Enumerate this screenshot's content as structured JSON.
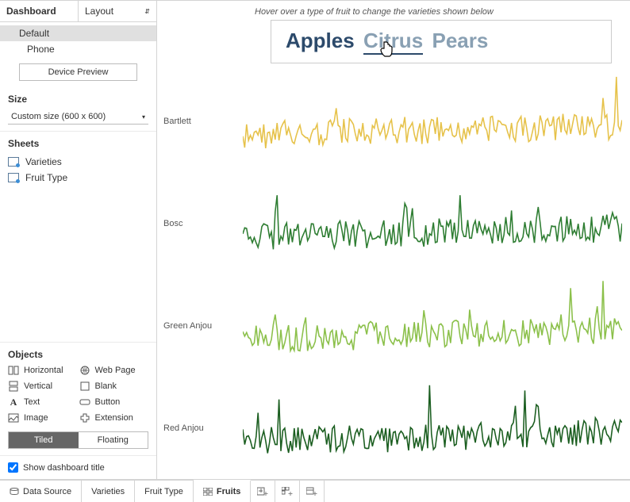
{
  "sidebar": {
    "top_tabs": {
      "dashboard": "Dashboard",
      "layout": "Layout"
    },
    "devices": {
      "default": "Default",
      "phone": "Phone"
    },
    "preview_btn": "Device Preview",
    "size": {
      "title": "Size",
      "value": "Custom size (600 x 600)"
    },
    "sheets": {
      "title": "Sheets",
      "items": [
        "Varieties",
        "Fruit Type"
      ]
    },
    "objects": {
      "title": "Objects",
      "items": [
        {
          "label": "Horizontal"
        },
        {
          "label": "Web Page"
        },
        {
          "label": "Vertical"
        },
        {
          "label": "Blank"
        },
        {
          "label": "Text"
        },
        {
          "label": "Button"
        },
        {
          "label": "Image"
        },
        {
          "label": "Extension"
        }
      ]
    },
    "tile_float": {
      "tiled": "Tiled",
      "floating": "Floating"
    },
    "show_title": "Show dashboard title"
  },
  "canvas": {
    "hint": "Hover over a type of fruit to change the varieties shown below",
    "fruit_words": {
      "apples": "Apples",
      "citrus": "Citrus",
      "pears": "Pears"
    },
    "charts": {
      "labels": [
        "Bartlett",
        "Bosc",
        "Green Anjou",
        "Red Anjou"
      ],
      "colors": [
        "#e6c24a",
        "#2e7d32",
        "#8bc04a",
        "#1b5e20"
      ]
    }
  },
  "bottom": {
    "data_source": "Data Source",
    "tabs": [
      "Varieties",
      "Fruit Type",
      "Fruits"
    ]
  },
  "chart_data": [
    {
      "type": "line",
      "title": "Bartlett",
      "xlabel": "",
      "ylabel": "",
      "x_range": [
        0,
        200
      ],
      "y_range": [
        0,
        100
      ],
      "series": [
        {
          "name": "Bartlett",
          "values_note": "dense noisy series ~200 points, mid baseline with spikes, rendered procedurally"
        }
      ]
    },
    {
      "type": "line",
      "title": "Bosc",
      "xlabel": "",
      "ylabel": "",
      "x_range": [
        0,
        200
      ],
      "y_range": [
        0,
        100
      ],
      "series": [
        {
          "name": "Bosc",
          "values_note": "dense noisy series, darker green, rising trend right side"
        }
      ]
    },
    {
      "type": "line",
      "title": "Green Anjou",
      "xlabel": "",
      "ylabel": "",
      "x_range": [
        0,
        200
      ],
      "y_range": [
        0,
        100
      ],
      "series": [
        {
          "name": "Green Anjou",
          "values_note": "dense noisy series, light green"
        }
      ]
    },
    {
      "type": "line",
      "title": "Red Anjou",
      "xlabel": "",
      "ylabel": "",
      "x_range": [
        0,
        200
      ],
      "y_range": [
        0,
        100
      ],
      "series": [
        {
          "name": "Red Anjou",
          "values_note": "dense noisy series, dark green, rising spikes right"
        }
      ]
    }
  ]
}
